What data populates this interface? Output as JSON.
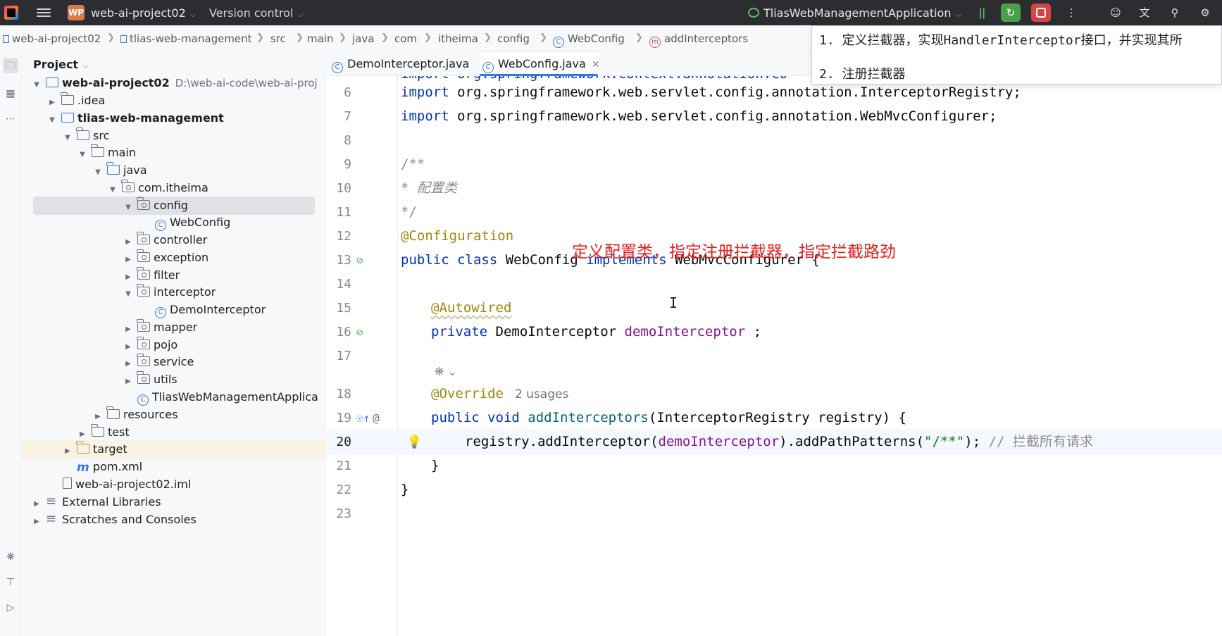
{
  "titlebar": {
    "project_badge": "WP",
    "project_name": "web-ai-project02",
    "version_control": "Version control",
    "run_config": "TliasWebManagementApplication",
    "buttons": {
      "pause": "pause-icon",
      "rerun": "rerun-icon",
      "stop": "stop-icon",
      "more": "more-icon",
      "user": "user-icon",
      "translate": "translate-icon",
      "search": "search-icon",
      "settings": "settings-icon"
    }
  },
  "breadcrumb": [
    "web-ai-project02",
    "tlias-web-management",
    "src",
    "main",
    "java",
    "com",
    "itheima",
    "config",
    "WebConfig",
    "addInterceptors"
  ],
  "project_panel": {
    "title": "Project",
    "root_path": "D:\\web-ai-code\\web-ai-proj",
    "tree": [
      {
        "label": "web-ai-project02"
      },
      {
        "label": ".idea"
      },
      {
        "label": "tlias-web-management"
      },
      {
        "label": "src"
      },
      {
        "label": "main"
      },
      {
        "label": "java"
      },
      {
        "label": "com.itheima"
      },
      {
        "label": "config"
      },
      {
        "label": "WebConfig"
      },
      {
        "label": "controller"
      },
      {
        "label": "exception"
      },
      {
        "label": "filter"
      },
      {
        "label": "interceptor"
      },
      {
        "label": "DemoInterceptor"
      },
      {
        "label": "mapper"
      },
      {
        "label": "pojo"
      },
      {
        "label": "service"
      },
      {
        "label": "utils"
      },
      {
        "label": "TliasWebManagementApplica"
      },
      {
        "label": "resources"
      },
      {
        "label": "test"
      },
      {
        "label": "target"
      },
      {
        "label": "pom.xml"
      },
      {
        "label": "web-ai-project02.iml"
      },
      {
        "label": "External Libraries"
      },
      {
        "label": "Scratches and Consoles"
      }
    ]
  },
  "tabs": [
    {
      "label": "DemoInterceptor.java",
      "active": false
    },
    {
      "label": "WebConfig.java",
      "active": true
    }
  ],
  "hint_popup": {
    "line1": "1. 定义拦截器，实现HandlerInterceptor接口，并实现其所",
    "line2": "2. 注册拦截器"
  },
  "editor": {
    "partial_top_line": "import org.springframework.context.annotation.Co",
    "lines": {
      "l6": {
        "num": "6",
        "kw": "import",
        "rest": " org.springframework.web.servlet.config.annotation.InterceptorRegistry;"
      },
      "l7": {
        "num": "7",
        "kw": "import",
        "rest": " org.springframework.web.servlet.config.annotation.WebMvcConfigurer;"
      },
      "l8": {
        "num": "8"
      },
      "l9": {
        "num": "9",
        "text": "/**"
      },
      "l10": {
        "num": "10",
        "star": " * ",
        "text": "配置类"
      },
      "l11": {
        "num": "11",
        "text": " */"
      },
      "l12": {
        "num": "12",
        "ann": "@Configuration"
      },
      "l13": {
        "num": "13",
        "kw1": "public class",
        "name": " WebConfig ",
        "kw2": "implements",
        "rest": " WebMvcConfigurer {"
      },
      "l14": {
        "num": "14"
      },
      "l15": {
        "num": "15",
        "ann": "@Autowired"
      },
      "l16": {
        "num": "16",
        "kw": "private",
        "type": " DemoInterceptor ",
        "field": "demoInterceptor",
        "rest": " ;"
      },
      "l17": {
        "num": "17"
      },
      "l18": {
        "num": "18",
        "ann": "@Override",
        "usages": "2 usages"
      },
      "l19": {
        "num": "19",
        "kw": "public void",
        "method": " addInterceptors",
        "rest": "(InterceptorRegistry registry) {"
      },
      "l20": {
        "num": "20",
        "pre": "registry.addInterceptor(",
        "field": "demoInterceptor",
        "mid": ").addPathPatterns(",
        "str": "\"/**\"",
        "post": ");",
        "comment": " // 拦截所有请求"
      },
      "l21": {
        "num": "21",
        "text": "}"
      },
      "l22": {
        "num": "22",
        "text": "}"
      },
      "l23": {
        "num": "23"
      }
    },
    "annotation_note": "定义配置类，指定注册拦截器，指定拦截路劲"
  },
  "colors": {
    "keyword": "#0033b3",
    "annotation": "#9e880d",
    "field": "#871094",
    "string": "#067d17",
    "comment": "#8c8c8c",
    "note": "#e51f1f",
    "accent": "#3574f0"
  }
}
